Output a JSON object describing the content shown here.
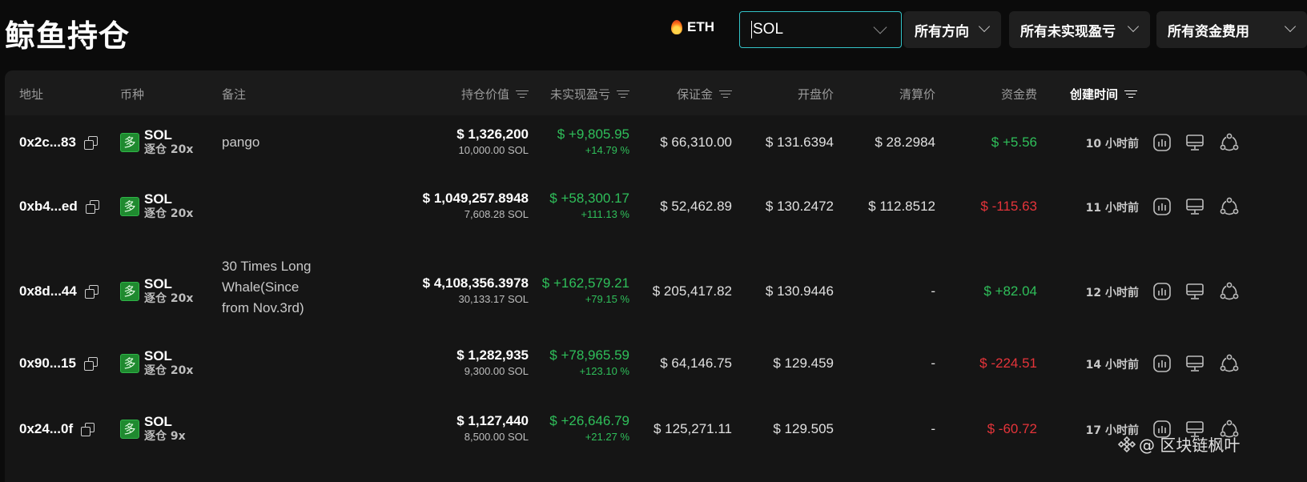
{
  "page": {
    "title": "鲸鱼持仓"
  },
  "filters": {
    "eth_label": "ETH",
    "search_value": "SOL",
    "direction_label": "所有方向",
    "upnl_label": "所有未实现盈亏",
    "funding_label": "所有资金费用"
  },
  "table": {
    "headers": {
      "address": "地址",
      "coin": "币种",
      "note": "备注",
      "position_value": "持仓价值",
      "upnl": "未实现盈亏",
      "margin": "保证金",
      "open_price": "开盘价",
      "liq_price": "清算价",
      "funding": "资金费",
      "created": "创建时间"
    },
    "rows": [
      {
        "address": "0x2c...83",
        "side": "多",
        "coin": "SOL",
        "mode": "逐仓 20x",
        "note": "pango",
        "value": "$ 1,326,200",
        "qty": "10,000.00 SOL",
        "upnl": "$ +9,805.95",
        "upnl_pct": "+14.79 %",
        "margin": "$ 66,310.00",
        "open": "$ 131.6394",
        "liq": "$ 28.2984",
        "funding": "$ +5.56",
        "funding_sign": "pos",
        "created": "10 小时前"
      },
      {
        "address": "0xb4...ed",
        "side": "多",
        "coin": "SOL",
        "mode": "逐仓 20x",
        "note": "",
        "value": "$ 1,049,257.8948",
        "qty": "7,608.28 SOL",
        "upnl": "$ +58,300.17",
        "upnl_pct": "+111.13 %",
        "margin": "$ 52,462.89",
        "open": "$ 130.2472",
        "liq": "$ 112.8512",
        "funding": "$ -115.63",
        "funding_sign": "neg",
        "created": "11 小时前"
      },
      {
        "address": "0x8d...44",
        "side": "多",
        "coin": "SOL",
        "mode": "逐仓 20x",
        "note": "30 Times Long Whale(Since from Nov.3rd)",
        "value": "$ 4,108,356.3978",
        "qty": "30,133.17 SOL",
        "upnl": "$ +162,579.21",
        "upnl_pct": "+79.15 %",
        "margin": "$ 205,417.82",
        "open": "$ 130.9446",
        "liq": "-",
        "funding": "$ +82.04",
        "funding_sign": "pos",
        "created": "12 小时前"
      },
      {
        "address": "0x90...15",
        "side": "多",
        "coin": "SOL",
        "mode": "逐仓 20x",
        "note": "",
        "value": "$ 1,282,935",
        "qty": "9,300.00 SOL",
        "upnl": "$ +78,965.59",
        "upnl_pct": "+123.10 %",
        "margin": "$ 64,146.75",
        "open": "$ 129.459",
        "liq": "-",
        "funding": "$ -224.51",
        "funding_sign": "neg",
        "created": "14 小时前"
      },
      {
        "address": "0x24...0f",
        "side": "多",
        "coin": "SOL",
        "mode": "逐仓 9x",
        "note": "",
        "value": "$ 1,127,440",
        "qty": "8,500.00 SOL",
        "upnl": "$ +26,646.79",
        "upnl_pct": "+21.27 %",
        "margin": "$ 125,271.11",
        "open": "$ 129.505",
        "liq": "-",
        "funding": "$ -60.72",
        "funding_sign": "neg",
        "created": "17 小时前"
      }
    ]
  },
  "watermark": {
    "text": "@ 区块链枫叶"
  },
  "colors": {
    "accent": "#33c3c7",
    "positive": "#2fbf5a",
    "negative": "#e5343a",
    "long_badge": "#1f8a2f"
  }
}
